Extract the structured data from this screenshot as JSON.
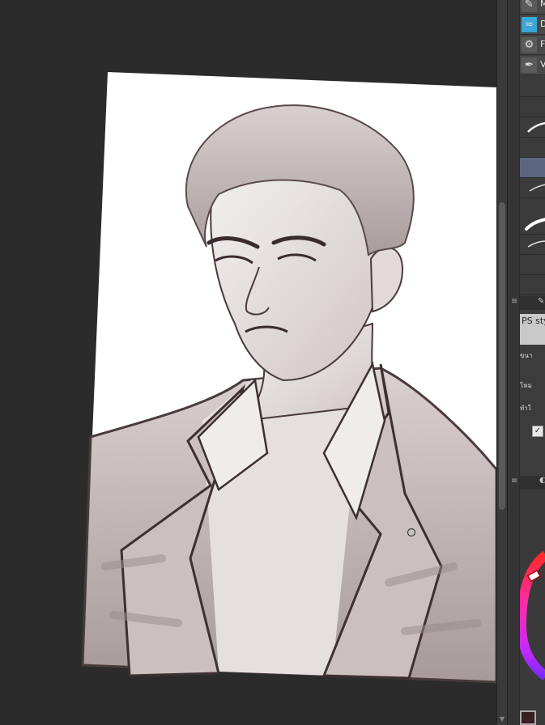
{
  "tool_panel": {
    "sub_tools": [
      {
        "label": "M",
        "icon": "pen-icon"
      },
      {
        "label": "D",
        "icon": "decoration-icon"
      },
      {
        "label": "F",
        "icon": "gear-icon"
      },
      {
        "label": "V",
        "icon": "vector-pen-icon"
      }
    ],
    "selected_brush_index": 5
  },
  "tool_property": {
    "preset_name": "PS sty",
    "rows": [
      "ขนา",
      "โหม",
      "ทำใ"
    ],
    "checkbox_checked": true
  },
  "colors": {
    "canvas_background": "#2b2b2b",
    "paper": "#ffffff",
    "sketch_line": "#4a3a3c",
    "shade": "#a89a9b",
    "current_color": "#3a1f22"
  }
}
